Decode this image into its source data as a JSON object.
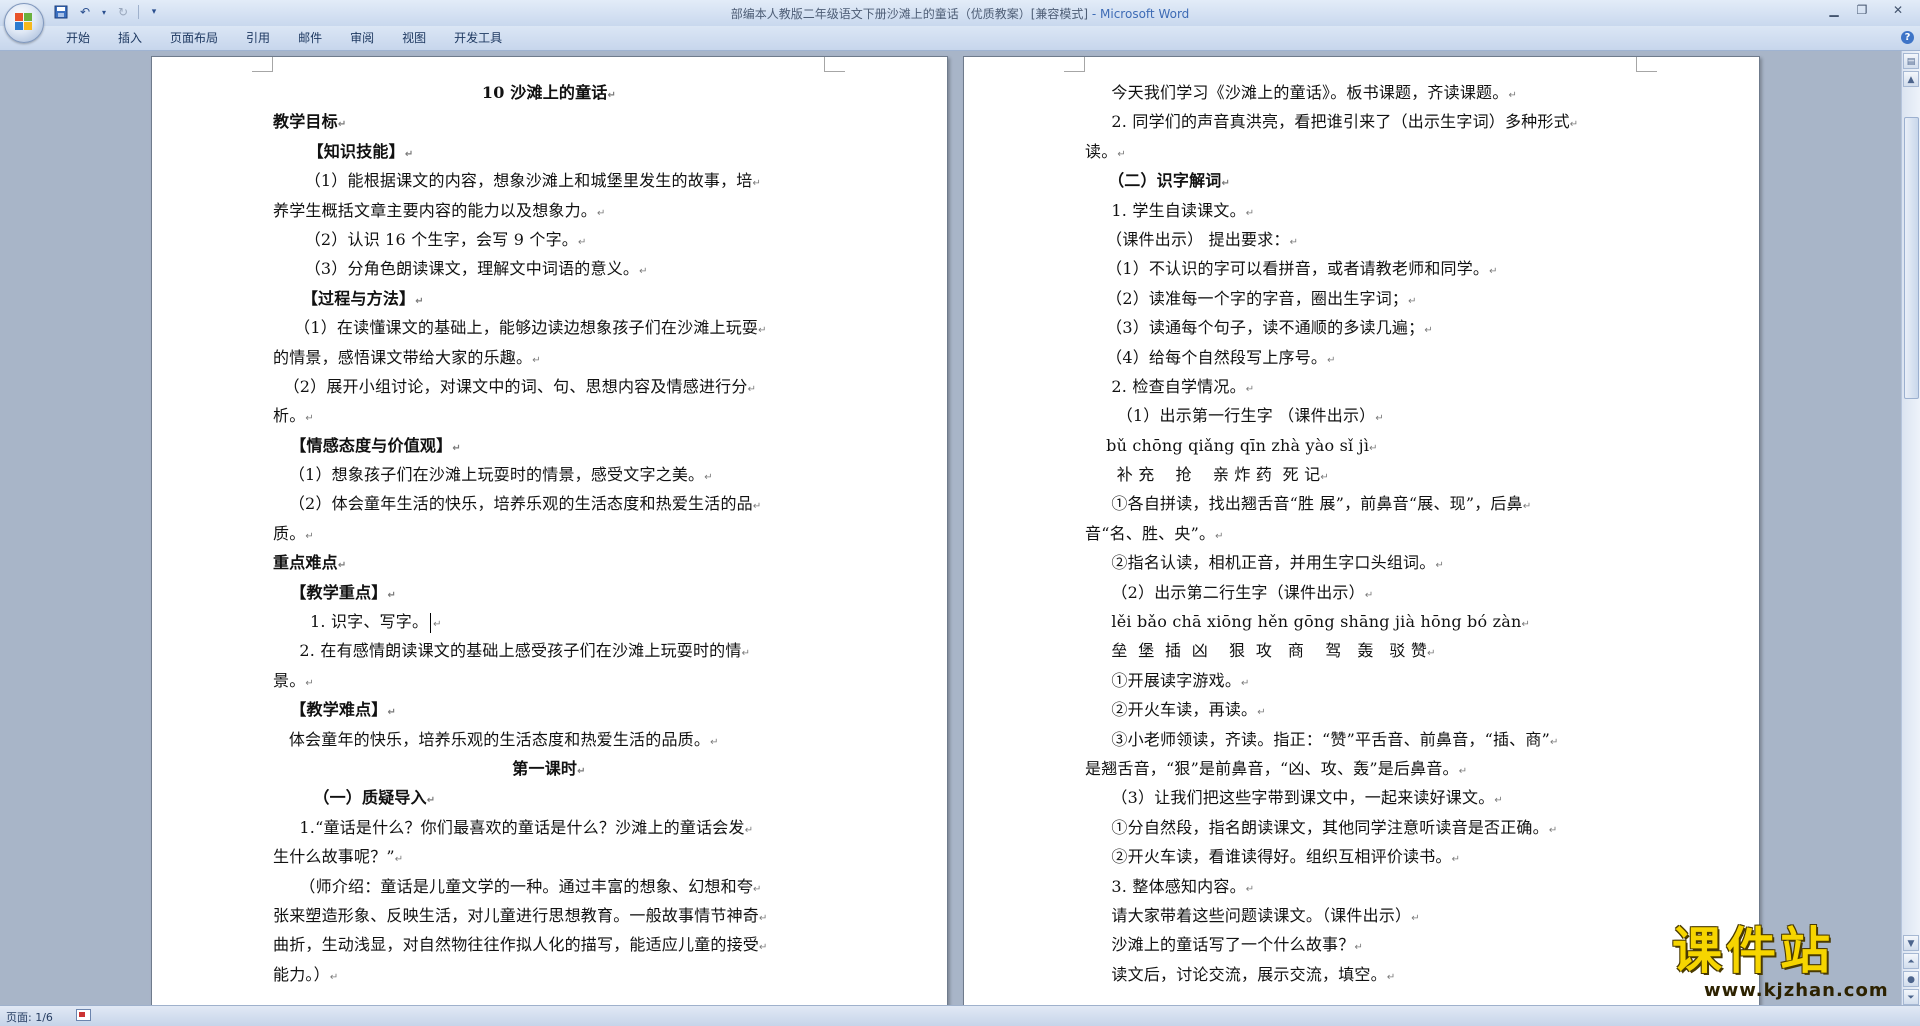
{
  "window": {
    "doc_name": "部编本人教版二年级语文下册沙滩上的童话（优质教案）[兼容模式]",
    "app_suffix": " - Microsoft Word"
  },
  "ribbon": {
    "tabs": [
      "开始",
      "插入",
      "页面布局",
      "引用",
      "邮件",
      "审阅",
      "视图",
      "开发工具"
    ]
  },
  "page1": {
    "lines": [
      {
        "text": "10 沙滩上的童话",
        "style": "b c"
      },
      {
        "text": "教学目标",
        "style": "b"
      },
      {
        "text": "      【知识技能】",
        "style": "b"
      },
      {
        "text": "      （1）能根据课文的内容，想象沙滩上和城堡里发生的故事，培",
        "style": ""
      },
      {
        "text": "养学生概括文章主要内容的能力以及想象力。",
        "style": ""
      },
      {
        "text": "      （2）认识 16 个生字，会写 9 个字。",
        "style": ""
      },
      {
        "text": "      （3）分角色朗读课文，理解文中词语的意义。",
        "style": ""
      },
      {
        "text": "     【过程与方法】",
        "style": "b"
      },
      {
        "text": "    （1）在读懂课文的基础上，能够边读边想象孩子们在沙滩上玩耍",
        "style": ""
      },
      {
        "text": "的情景，感悟课文带给大家的乐趣。",
        "style": ""
      },
      {
        "text": "  （2）展开小组讨论，对课文中的词、句、思想内容及情感进行分",
        "style": ""
      },
      {
        "text": "析。",
        "style": ""
      },
      {
        "text": "   【情感态度与价值观】",
        "style": "b"
      },
      {
        "text": "   （1）想象孩子们在沙滩上玩耍时的情景，感受文字之美。",
        "style": ""
      },
      {
        "text": "   （2）体会童年生活的快乐，培养乐观的生活态度和热爱生活的品",
        "style": ""
      },
      {
        "text": "质。",
        "style": ""
      },
      {
        "text": "重点难点",
        "style": "b"
      },
      {
        "text": "   【教学重点】",
        "style": "b"
      },
      {
        "text": "       1. 识字、写字。",
        "style": "",
        "cursor": true
      },
      {
        "text": "     2. 在有感情朗读课文的基础上感受孩子们在沙滩上玩耍时的情",
        "style": ""
      },
      {
        "text": "景。",
        "style": ""
      },
      {
        "text": "   【教学难点】",
        "style": "b"
      },
      {
        "text": "   体会童年的快乐，培养乐观的生活态度和热爱生活的品质。",
        "style": ""
      },
      {
        "text": "第一课时",
        "style": "b c"
      },
      {
        "text": "       （一）质疑导入",
        "style": "b"
      },
      {
        "text": "     1.“童话是什么？你们最喜欢的童话是什么？沙滩上的童话会发",
        "style": ""
      },
      {
        "text": "生什么故事呢？”",
        "style": ""
      },
      {
        "text": "     （师介绍：童话是儿童文学的一种。通过丰富的想象、幻想和夸",
        "style": ""
      },
      {
        "text": "张来塑造形象、反映生活，对儿童进行思想教育。一般故事情节神奇",
        "style": ""
      },
      {
        "text": "曲折，生动浅显，对自然物往往作拟人化的描写，能适应儿童的接受",
        "style": ""
      },
      {
        "text": "能力。）",
        "style": ""
      }
    ]
  },
  "page2": {
    "lines": [
      {
        "text": "     今天我们学习《沙滩上的童话》。板书课题，齐读课题。",
        "style": ""
      },
      {
        "text": "     2. 同学们的声音真洪亮，看把谁引来了（出示生字词）多种形式",
        "style": ""
      },
      {
        "text": "读。",
        "style": ""
      },
      {
        "text": "    （二）识字解词",
        "style": "b"
      },
      {
        "text": "     1. 学生自读课文。",
        "style": ""
      },
      {
        "text": "    （课件出示） 提出要求：",
        "style": ""
      },
      {
        "text": "    （1）不认识的字可以看拼音，或者请教老师和同学。",
        "style": ""
      },
      {
        "text": "    （2）读准每一个字的字音，圈出生字词；",
        "style": ""
      },
      {
        "text": "    （3）读通每个句子，读不通顺的多读几遍；",
        "style": ""
      },
      {
        "text": "    （4）给每个自然段写上序号。",
        "style": ""
      },
      {
        "text": "     2. 检查自学情况。",
        "style": ""
      },
      {
        "text": "      （1）出示第一行生字 （课件出示）",
        "style": ""
      },
      {
        "text": "    bǔ chōng qiǎng qīn zhà yào sǐ jì",
        "style": ""
      },
      {
        "text": "      补 充    抢    亲 炸 药  死 记",
        "style": ""
      },
      {
        "text": "     ①各自拼读，找出翘舌音“胜 展”，前鼻音“展、现”，后鼻",
        "style": ""
      },
      {
        "text": "音“名、胜、央”。",
        "style": ""
      },
      {
        "text": "     ②指名认读，相机正音，并用生字口头组词。",
        "style": ""
      },
      {
        "text": "     （2）出示第二行生字（课件出示）",
        "style": ""
      },
      {
        "text": "     lěi bǎo chā xiōng hěn gōng shāng jià hōng bó zàn",
        "style": ""
      },
      {
        "text": "     垒  堡  插  凶    狠  攻   商    驾   轰   驳 赞",
        "style": ""
      },
      {
        "text": "     ①开展读字游戏。",
        "style": ""
      },
      {
        "text": "     ②开火车读，再读。",
        "style": ""
      },
      {
        "text": "     ③小老师领读，齐读。指正：“赞”平舌音、前鼻音，“插、商”",
        "style": ""
      },
      {
        "text": "是翘舌音，“狠”是前鼻音，“凶、攻、轰”是后鼻音。",
        "style": ""
      },
      {
        "text": "     （3）让我们把这些字带到课文中，一起来读好课文。",
        "style": ""
      },
      {
        "text": "     ①分自然段，指名朗读课文，其他同学注意听读音是否正确。",
        "style": ""
      },
      {
        "text": "     ②开火车读，看谁读得好。组织互相评价读书。",
        "style": ""
      },
      {
        "text": "     3. 整体感知内容。",
        "style": ""
      },
      {
        "text": "     请大家带着这些问题读课文。（课件出示）",
        "style": ""
      },
      {
        "text": "     沙滩上的童话写了一个什么故事？",
        "style": ""
      },
      {
        "text": "     读文后，讨论交流，展示交流，填空。",
        "style": ""
      }
    ]
  },
  "status": {
    "page_info": "页面: 1/6"
  },
  "watermark": {
    "cn": "课件站",
    "en": "www.kjzhan.com"
  },
  "colors": {
    "ribbon_bg": "#c7d6ec",
    "workspace_bg": "#a8b5c8",
    "watermark_yellow": "#f6d500"
  }
}
